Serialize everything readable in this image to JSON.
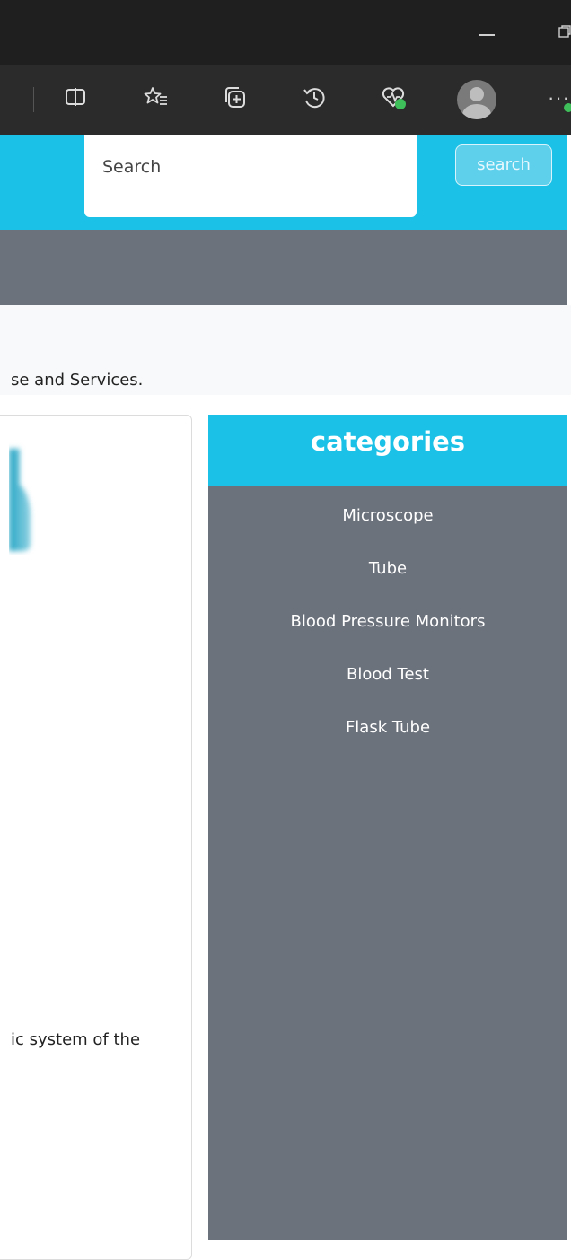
{
  "browser": {
    "toolbar_icons": [
      "split-screen-icon",
      "favorites-icon",
      "collections-icon",
      "history-icon",
      "browser-essentials-icon",
      "profile-icon",
      "more-icon"
    ],
    "more_label": "···"
  },
  "header": {
    "search_placeholder": "Search",
    "search_button": "search",
    "accent_color": "#1bc1e6",
    "nav_color": "#6c727c"
  },
  "intro": {
    "text": "se and Services."
  },
  "product": {
    "description_fragment": "ic system of the"
  },
  "categories": {
    "title": "categories",
    "items": [
      {
        "label": "Microscope"
      },
      {
        "label": "Tube"
      },
      {
        "label": "Blood Pressure Monitors"
      },
      {
        "label": "Blood Test"
      },
      {
        "label": "Flask Tube"
      }
    ]
  }
}
